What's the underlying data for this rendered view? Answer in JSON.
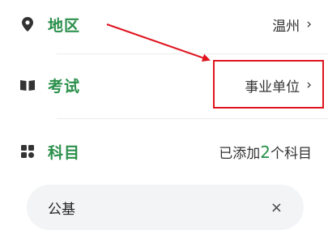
{
  "colors": {
    "accent": "#2a8f4a",
    "icon": "#333333",
    "annotation_red": "#e0141e",
    "tag_bg": "#f3f4f6"
  },
  "rows": [
    {
      "icon": "location-pin-icon",
      "label": "地区",
      "value": "温州",
      "chevron": "›"
    },
    {
      "icon": "book-icon",
      "label": "考试",
      "value": "事业单位",
      "chevron": "›"
    },
    {
      "icon": "grid-icon",
      "label": "科目",
      "value_prefix": "已添加",
      "value_count": "2",
      "value_suffix": "个科目"
    }
  ],
  "tags": [
    {
      "label": "公基",
      "close": "×"
    }
  ]
}
